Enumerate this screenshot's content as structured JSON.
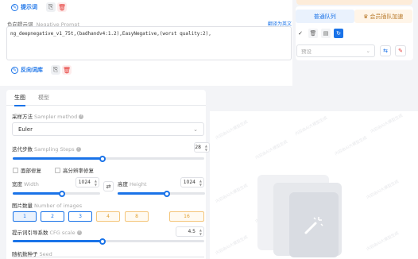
{
  "prompt": {
    "positive_chip": "提示词",
    "negative_label": "负向提示词",
    "negative_label_en": "Negative Prompt",
    "translate_link": "翻译为英文",
    "negative_text": "ng_deepnegative_v1_75t,(badhandv4:1.2),EasyNegative,(worst quality:2),",
    "reverse_chip": "反向词库"
  },
  "queue": {
    "normal": "普通队列",
    "vip": "会员插队加速",
    "preset_placeholder": "预设"
  },
  "tabs": [
    "生图",
    "模型"
  ],
  "sampler": {
    "label": "采样方法",
    "label_en": "Sampler method",
    "value": "Euler"
  },
  "steps": {
    "label": "迭代步数",
    "label_en": "Sampling Steps",
    "value": "28",
    "fraction": 0.47
  },
  "options": {
    "face_restore": "面部修复",
    "hires_fix": "高分辨率修复"
  },
  "width": {
    "label": "宽度",
    "label_en": "Width",
    "value": "1024",
    "fraction": 0.56
  },
  "height": {
    "label": "高度",
    "label_en": "Height",
    "value": "1024",
    "fraction": 0.56
  },
  "batch": {
    "label": "图片数量",
    "label_en": "Number of images",
    "options": [
      "1",
      "2",
      "3",
      "4",
      "8",
      "16"
    ],
    "selected": "1"
  },
  "cfg": {
    "label": "提示词引导系数",
    "label_en": "CFG scale",
    "value": "4.5",
    "fraction": 0.47
  },
  "seed": {
    "label": "随机数种子",
    "label_en": "Seed"
  },
  "preview": {
    "watermark": "内容由AI大模型生成"
  },
  "colors": {
    "accent": "#1a73e8",
    "vip": "#e0a033",
    "danger": "#e53935"
  }
}
